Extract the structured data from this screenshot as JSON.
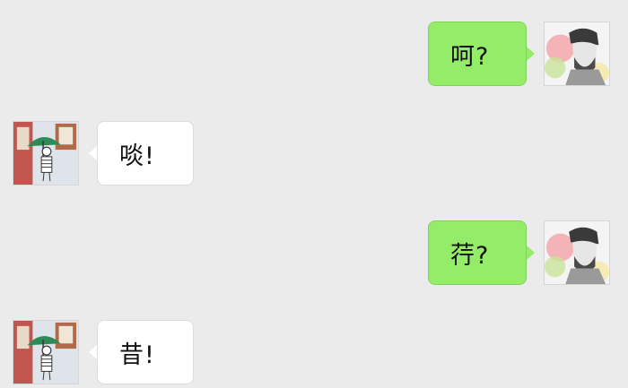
{
  "messages": [
    {
      "side": "sent",
      "text": "呵?",
      "avatar": "avatar-man-icon"
    },
    {
      "side": "received",
      "text": "啖!",
      "avatar": "avatar-girl-umbrella-icon"
    },
    {
      "side": "sent",
      "text": "荇?",
      "avatar": "avatar-man-icon"
    },
    {
      "side": "received",
      "text": "昔!",
      "avatar": "avatar-girl-umbrella-icon"
    }
  ],
  "colors": {
    "background": "#ebebeb",
    "sent_bubble": "#95ec69",
    "received_bubble": "#ffffff"
  }
}
